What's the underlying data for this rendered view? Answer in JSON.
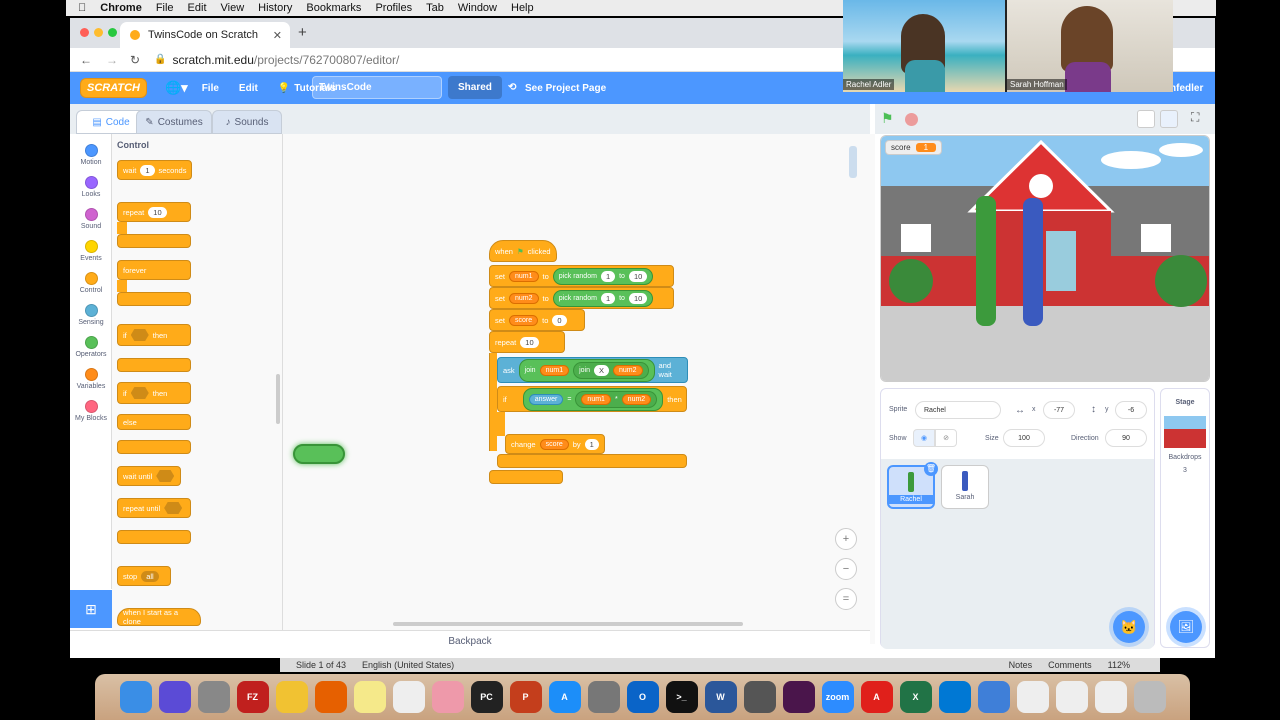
{
  "macmenu": {
    "app": "Chrome",
    "items": [
      "File",
      "Edit",
      "View",
      "History",
      "Bookmarks",
      "Profiles",
      "Tab",
      "Window",
      "Help"
    ]
  },
  "browser": {
    "tab_title": "TwinsCode on Scratch",
    "url_domain": "scratch.mit.edu",
    "url_path": "/projects/762700807/editor/"
  },
  "scratch_menu": {
    "logo": "SCRATCH",
    "file": "File",
    "edit": "Edit",
    "tutorials": "Tutorials",
    "project_title": "TwinsCode",
    "shared": "Shared",
    "see_page": "See Project Page",
    "user": "hfedler"
  },
  "editor_tabs": [
    "Code",
    "Costumes",
    "Sounds"
  ],
  "categories": [
    {
      "label": "Motion",
      "color": "#4c97ff"
    },
    {
      "label": "Looks",
      "color": "#9966ff"
    },
    {
      "label": "Sound",
      "color": "#cf63cf"
    },
    {
      "label": "Events",
      "color": "#ffd500"
    },
    {
      "label": "Control",
      "color": "#ffab19"
    },
    {
      "label": "Sensing",
      "color": "#5cb1d6"
    },
    {
      "label": "Operators",
      "color": "#59c059"
    },
    {
      "label": "Variables",
      "color": "#ff8c1a"
    },
    {
      "label": "My Blocks",
      "color": "#ff6680"
    }
  ],
  "palette": {
    "heading": "Control",
    "wait": "wait",
    "wait_val": "1",
    "seconds": "seconds",
    "repeat": "repeat",
    "repeat_val": "10",
    "forever": "forever",
    "if": "if",
    "then": "then",
    "else": "else",
    "wait_until": "wait until",
    "repeat_until": "repeat until",
    "stop": "stop",
    "stop_val": "all",
    "clone": "when I start as a clone"
  },
  "script": {
    "when": "when",
    "clicked": "clicked",
    "set": "set",
    "num1": "num1",
    "num2": "num2",
    "to": "to",
    "pick_random": "pick random",
    "r1": "1",
    "r2": "10",
    "score": "score",
    "score_val": "0",
    "repeat": "repeat",
    "repeat_val": "10",
    "ask": "ask",
    "join": "join",
    "x": "X",
    "and_wait": "and wait",
    "if": "if",
    "answer": "answer",
    "eq": "=",
    "times": "*",
    "then": "then",
    "change": "change",
    "by": "by",
    "by_val": "1"
  },
  "backpack": "Backpack",
  "stage": {
    "var_name": "score",
    "var_val": "1"
  },
  "sprite": {
    "sprite_lbl": "Sprite",
    "name": "Rachel",
    "x_lbl": "x",
    "x": "-77",
    "y_lbl": "y",
    "y": "-6",
    "show": "Show",
    "size_lbl": "Size",
    "size": "100",
    "dir_lbl": "Direction",
    "dir": "90",
    "sprites": [
      "Rachel",
      "Sarah"
    ]
  },
  "backdrop": {
    "stage": "Stage",
    "backdrops": "Backdrops",
    "count": "3"
  },
  "video": {
    "p1": "Rachel Adler",
    "p2": "Sarah Hoffman"
  },
  "status": {
    "slide": "Slide 1 of 43",
    "lang": "English (United States)",
    "notes": "Notes",
    "comments": "Comments",
    "zoom": "112%"
  },
  "dock": [
    {
      "name": "finder",
      "label": "",
      "color": "#3a8ee6"
    },
    {
      "name": "siri",
      "label": "",
      "color": "#5b4bd6"
    },
    {
      "name": "launchpad",
      "label": "",
      "color": "#888"
    },
    {
      "name": "filezilla",
      "label": "FZ",
      "color": "#c0201e"
    },
    {
      "name": "chrome",
      "label": "",
      "color": "#f1c232"
    },
    {
      "name": "firefox",
      "label": "",
      "color": "#e66000"
    },
    {
      "name": "notes",
      "label": "",
      "color": "#f5e98a"
    },
    {
      "name": "lists",
      "label": "",
      "color": "#eee"
    },
    {
      "name": "photos",
      "label": "",
      "color": "#e9a"
    },
    {
      "name": "pycharm",
      "label": "PC",
      "color": "#222"
    },
    {
      "name": "powerpoint",
      "label": "P",
      "color": "#c43e1c"
    },
    {
      "name": "appstore",
      "label": "A",
      "color": "#1c8ef9"
    },
    {
      "name": "settings",
      "label": "",
      "color": "#777"
    },
    {
      "name": "outlook",
      "label": "O",
      "color": "#0a64c8"
    },
    {
      "name": "terminal",
      "label": ">_",
      "color": "#111"
    },
    {
      "name": "word",
      "label": "W",
      "color": "#2b579a"
    },
    {
      "name": "calculator",
      "label": "",
      "color": "#555"
    },
    {
      "name": "slack",
      "label": "",
      "color": "#4a154b"
    },
    {
      "name": "zoom",
      "label": "zoom",
      "color": "#2d8cff"
    },
    {
      "name": "acrobat",
      "label": "A",
      "color": "#e0201b"
    },
    {
      "name": "excel",
      "label": "X",
      "color": "#217346"
    },
    {
      "name": "vscode",
      "label": "",
      "color": "#0078d4"
    },
    {
      "name": "globe",
      "label": "",
      "color": "#3f7fd8"
    },
    {
      "name": "doc",
      "label": "",
      "color": "#eee"
    },
    {
      "name": "doc2",
      "label": "",
      "color": "#eee"
    },
    {
      "name": "doc3",
      "label": "",
      "color": "#eee"
    },
    {
      "name": "trash",
      "label": "",
      "color": "#bbb"
    }
  ]
}
